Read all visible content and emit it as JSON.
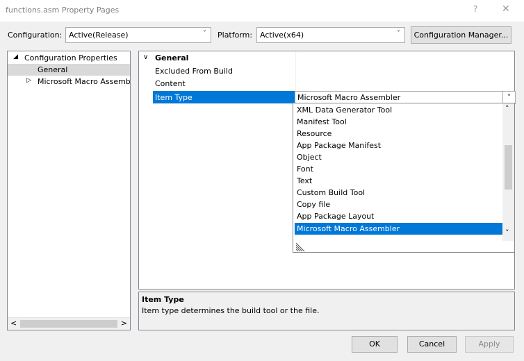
{
  "window": {
    "title": "functions.asm Property Pages",
    "help_glyph": "?",
    "close_glyph": "✕"
  },
  "toolbar": {
    "configuration_label": "Configuration:",
    "configuration_value": "Active(Release)",
    "platform_label": "Platform:",
    "platform_value": "Active(x64)",
    "config_manager_label": "Configuration Manager..."
  },
  "tree": {
    "items": [
      {
        "label": "Configuration Properties",
        "expander": "◢"
      },
      {
        "label": "General",
        "expander": ""
      },
      {
        "label": "Microsoft Macro Assembler",
        "expander": "▷"
      }
    ],
    "scroll_left": "<",
    "scroll_right": ">"
  },
  "grid": {
    "category_glyph": "∨",
    "category": "General",
    "rows": [
      {
        "name": "Excluded From Build",
        "value": ""
      },
      {
        "name": "Content",
        "value": ""
      },
      {
        "name": "Item Type",
        "value": "Microsoft Macro Assembler"
      }
    ]
  },
  "dropdown": {
    "options": [
      "XML Data Generator Tool",
      "Manifest Tool",
      "Resource",
      "App Package Manifest",
      "Object",
      "Font",
      "Text",
      "Custom Build Tool",
      "Copy file",
      "App Package Layout",
      "Microsoft Macro Assembler"
    ],
    "selected_index": 10,
    "scroll_up": "˄",
    "scroll_down": "˅",
    "combo_arrow": "˅"
  },
  "description": {
    "title": "Item Type",
    "text": "Item type determines the build tool or the file."
  },
  "buttons": {
    "ok": "OK",
    "cancel": "Cancel",
    "apply": "Apply"
  },
  "colors": {
    "selection": "#0078d7",
    "tree_selected": "#d9d9d9"
  }
}
